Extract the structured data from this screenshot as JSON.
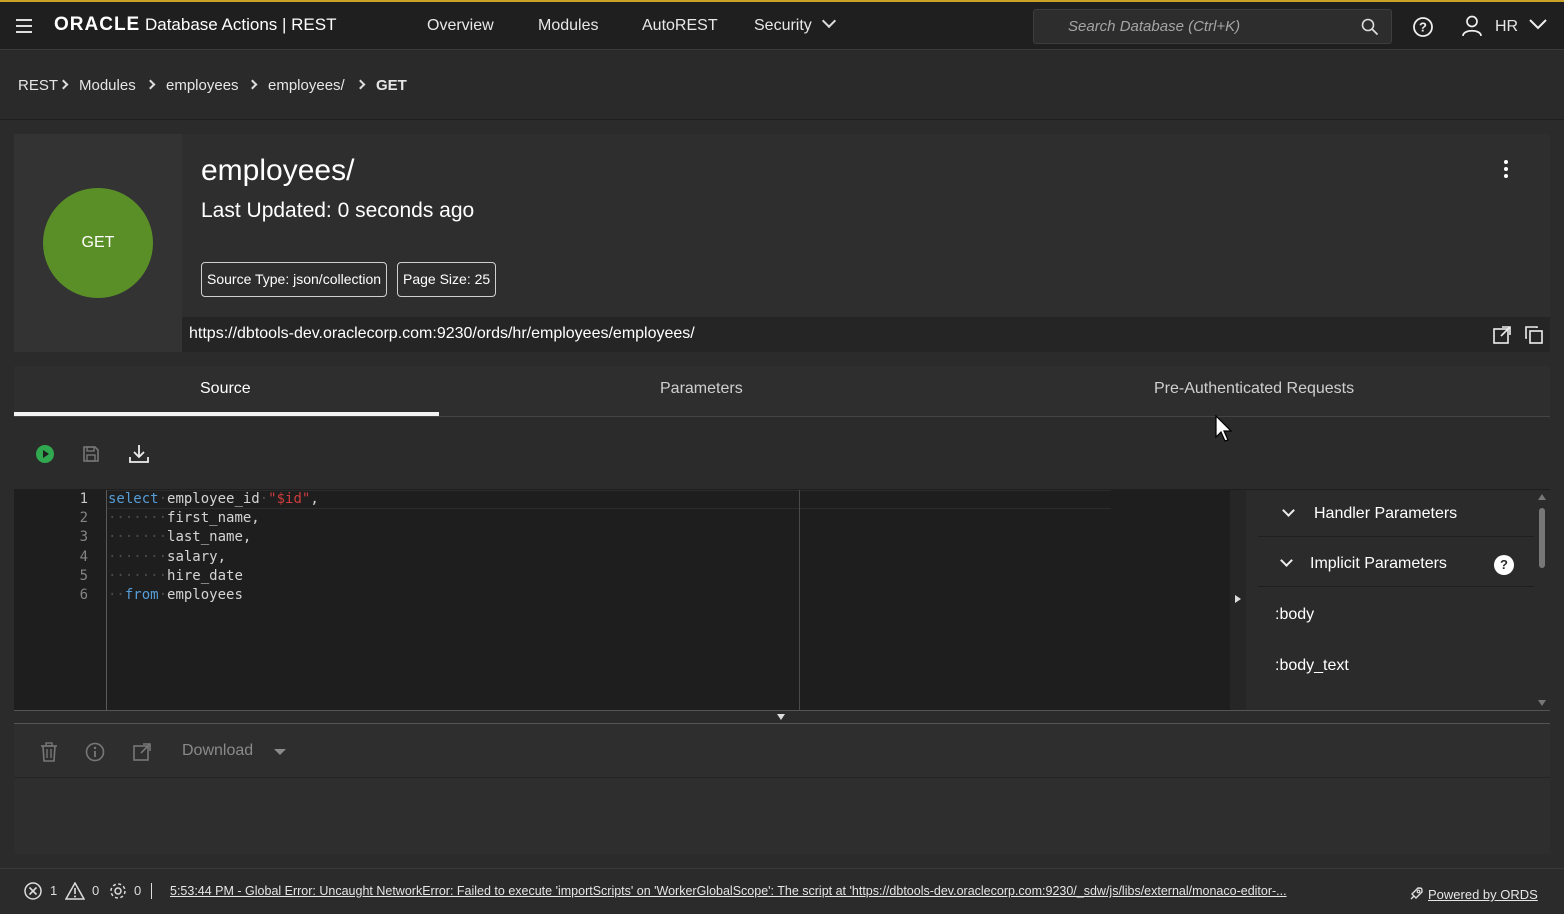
{
  "app": {
    "brand_logo": "ORACLE",
    "brand_product": "Database Actions |",
    "brand_section": "REST"
  },
  "nav": {
    "items": [
      "Overview",
      "Modules",
      "AutoREST",
      "Security"
    ]
  },
  "search": {
    "placeholder": "Search Database (Ctrl+K)"
  },
  "user": {
    "name": "HR"
  },
  "breadcrumb": [
    "REST",
    "Modules",
    "employees",
    "employees/",
    "GET"
  ],
  "handler": {
    "method": "GET",
    "title": "employees/",
    "last_updated": "Last Updated: 0 seconds ago",
    "source_type": "Source Type: json/collection",
    "page_size": "Page Size: 25",
    "url": "https://dbtools-dev.oraclecorp.com:9230/ords/hr/employees/employees/",
    "method_color": "#5a8f28"
  },
  "tabs": [
    "Source",
    "Parameters",
    "Pre-Authenticated Requests"
  ],
  "editor": {
    "line_numbers": [
      "1",
      "2",
      "3",
      "4",
      "5",
      "6"
    ],
    "line1_kw": "select",
    "line1_col": "employee_id",
    "line1_str": "\"$id\"",
    "line1_end": ",",
    "line2": "first_name,",
    "line3": "last_name,",
    "line4": "salary,",
    "line5": "hire_date",
    "line6_kw": "from",
    "line6_tbl": "employees"
  },
  "side_panel": {
    "handler_params": "Handler Parameters",
    "implicit_params": "Implicit Parameters",
    "help": "?",
    "params": [
      ":body",
      ":body_text"
    ]
  },
  "results": {
    "download_label": "Download"
  },
  "status": {
    "errors": "1",
    "warnings": "0",
    "settings": "0",
    "message": "5:53:44 PM - Global Error: Uncaught NetworkError: Failed to execute 'importScripts' on 'WorkerGlobalScope': The script at 'https://dbtools-dev.oraclecorp.com:9230/_sdw/js/libs/external/monaco-editor-...",
    "powered_by": "Powered by ORDS"
  }
}
